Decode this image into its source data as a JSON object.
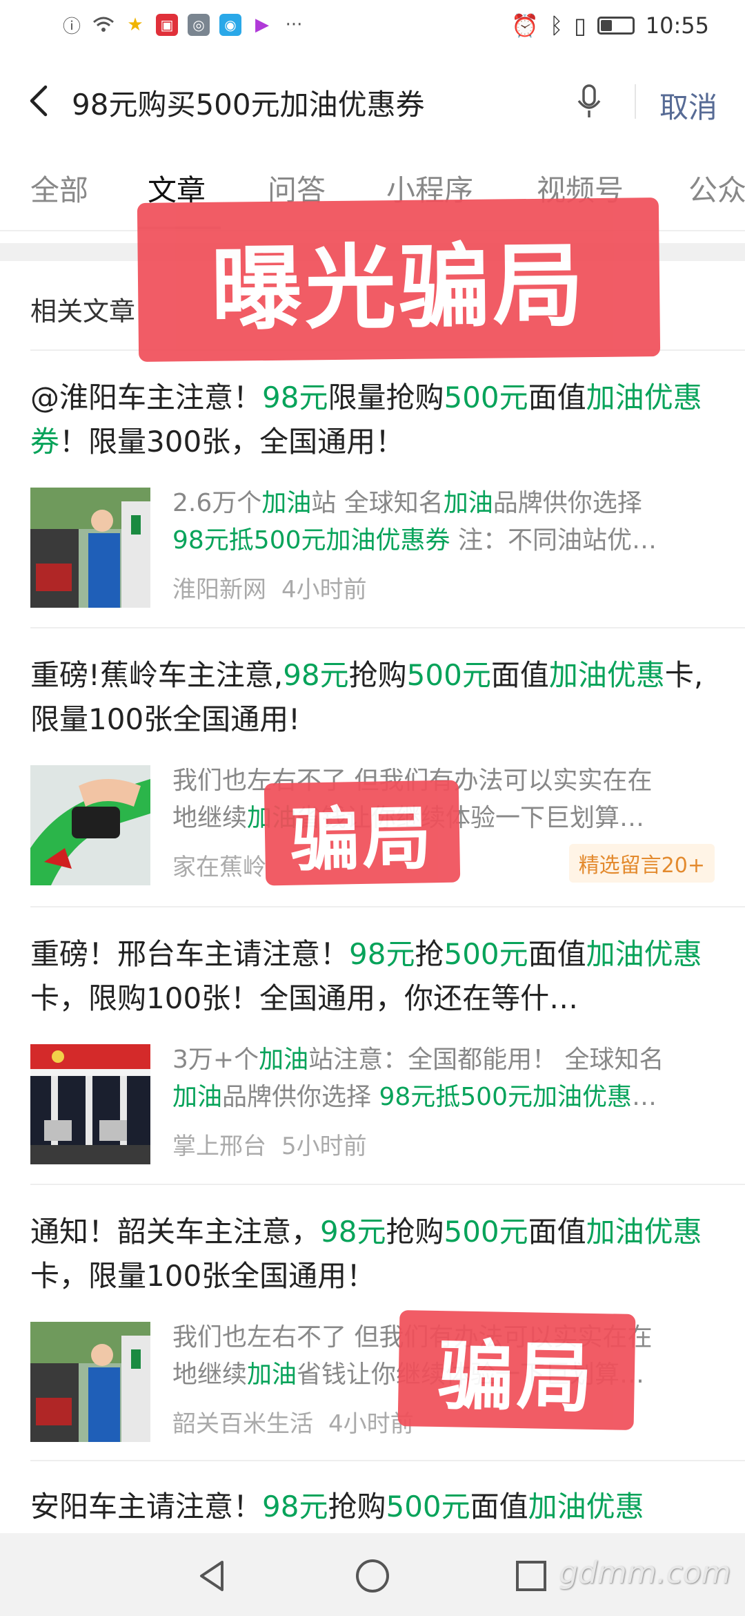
{
  "status_bar": {
    "time": "10:55",
    "more": "···"
  },
  "search": {
    "query": "98元购买500元加油优惠券",
    "cancel_label": "取消"
  },
  "tabs": [
    "全部",
    "文章",
    "问答",
    "小程序",
    "视频号",
    "公众"
  ],
  "section_title": "相关文章",
  "overlays": {
    "top_stamp": "曝光骗局",
    "stamp2": "骗局",
    "stamp3": "骗局"
  },
  "articles": [
    {
      "title_parts": [
        {
          "t": "@淮阳车主注意！"
        },
        {
          "t": "98元",
          "hl": true
        },
        {
          "t": "限量抢购"
        },
        {
          "t": "500元",
          "hl": true
        },
        {
          "t": "面值"
        },
        {
          "t": "加油",
          "hl": true
        },
        {
          "t": "优惠券",
          "hl": true
        },
        {
          "t": "！限量300张，全国通用！"
        }
      ],
      "snippet_lines": [
        [
          {
            "t": "2.6万个"
          },
          {
            "t": "加油",
            "hl": true
          },
          {
            "t": "站 全球知名"
          },
          {
            "t": "加油",
            "hl": true
          },
          {
            "t": "品牌供你选择"
          }
        ],
        [
          {
            "t": "98元抵500元加油优惠券",
            "hl": true
          },
          {
            "t": " 注：不同油站优…"
          }
        ]
      ],
      "source": "淮阳新网",
      "time": "4小时前",
      "badge": ""
    },
    {
      "title_parts": [
        {
          "t": "重磅!蕉岭车主注意,"
        },
        {
          "t": "98元",
          "hl": true
        },
        {
          "t": "抢购"
        },
        {
          "t": "500元",
          "hl": true
        },
        {
          "t": "面值"
        },
        {
          "t": "加油优惠",
          "hl": true
        },
        {
          "t": "卡,限量100张全国通用!"
        }
      ],
      "snippet_lines": [
        [
          {
            "t": "我们也左右不了 但我们有办法可以实实在在"
          }
        ],
        [
          {
            "t": "地继续"
          },
          {
            "t": "加油",
            "hl": true
          },
          {
            "t": "省钱让你继续体验一下巨划算…"
          }
        ]
      ],
      "source": "家在蕉岭",
      "time": "",
      "badge": "精选留言20+"
    },
    {
      "title_parts": [
        {
          "t": "重磅！邢台车主请注意！"
        },
        {
          "t": "98元",
          "hl": true
        },
        {
          "t": "抢"
        },
        {
          "t": "500元",
          "hl": true
        },
        {
          "t": "面值"
        },
        {
          "t": "加油优惠",
          "hl": true
        },
        {
          "t": "卡，限购100张！全国通用，你还在等什…"
        }
      ],
      "snippet_lines": [
        [
          {
            "t": "3万+个"
          },
          {
            "t": "加油",
            "hl": true
          },
          {
            "t": "站注意：全国都能用！ 全球知名"
          }
        ],
        [
          {
            "t": "加油",
            "hl": true
          },
          {
            "t": "品牌供你选择 "
          },
          {
            "t": "98元抵500元加油优惠",
            "hl": true
          },
          {
            "t": "…"
          }
        ]
      ],
      "source": "掌上邢台",
      "time": "5小时前",
      "badge": ""
    },
    {
      "title_parts": [
        {
          "t": "通知！韶关车主注意，"
        },
        {
          "t": "98元",
          "hl": true
        },
        {
          "t": "抢购"
        },
        {
          "t": "500元",
          "hl": true
        },
        {
          "t": "面值"
        },
        {
          "t": "加油优惠",
          "hl": true
        },
        {
          "t": "卡，限量100张全国通用！"
        }
      ],
      "snippet_lines": [
        [
          {
            "t": "我们也左右不了 但我们有办法可以实实在在"
          }
        ],
        [
          {
            "t": "地继续"
          },
          {
            "t": "加油",
            "hl": true
          },
          {
            "t": "省钱让你继续体验一下巨划算…"
          }
        ]
      ],
      "source": "韶关百米生活",
      "time": "4小时前",
      "badge": ""
    },
    {
      "title_parts": [
        {
          "t": "安阳车主请注意！"
        },
        {
          "t": "98元",
          "hl": true
        },
        {
          "t": "抢购"
        },
        {
          "t": "500元",
          "hl": true
        },
        {
          "t": "面值"
        },
        {
          "t": "加油优惠",
          "hl": true
        }
      ],
      "snippet_lines": [],
      "source": "",
      "time": "",
      "badge": ""
    }
  ],
  "watermark": "gdmm.com",
  "colors": {
    "highlight": "#07a35a",
    "link": "#576b95",
    "stamp": "#f0505a"
  }
}
